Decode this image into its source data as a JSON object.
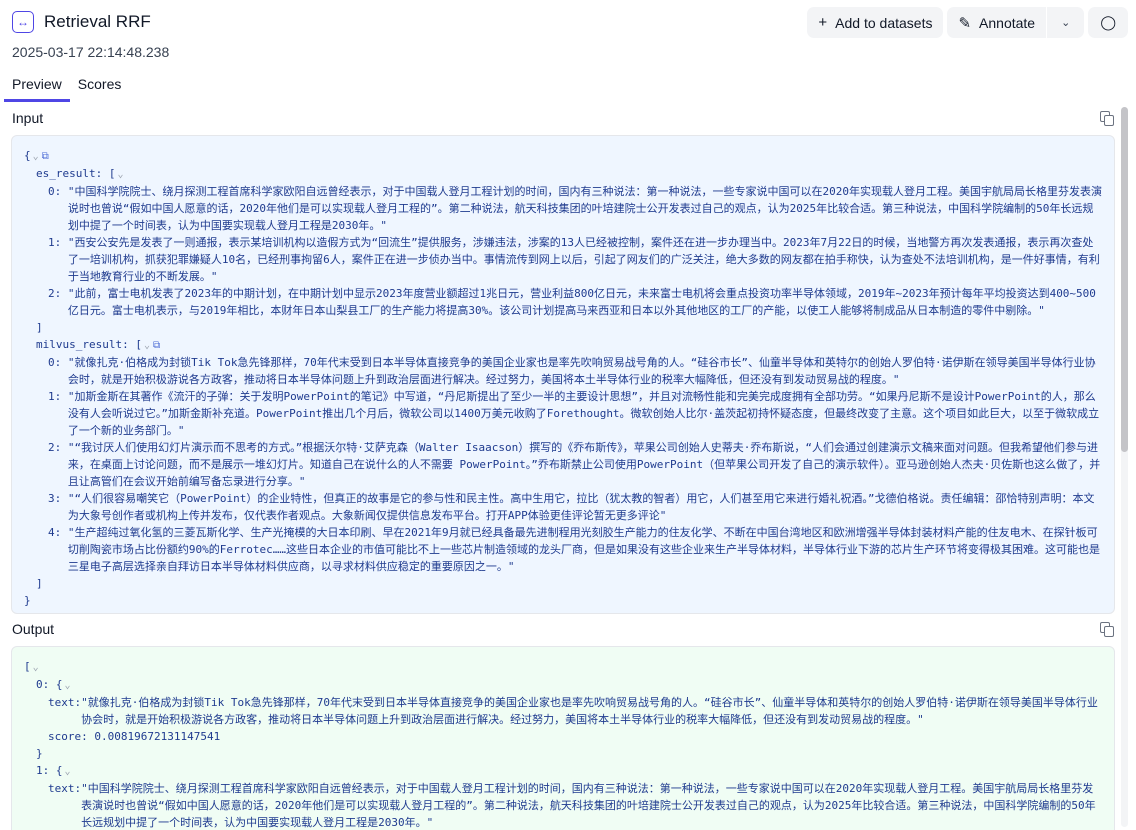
{
  "header": {
    "title": "Retrieval RRF",
    "timestamp": "2025-03-17 22:14:48.238",
    "add_to_datasets_label": "Add to datasets",
    "annotate_label": "Annotate"
  },
  "tabs": [
    {
      "label": "Preview",
      "active": true
    },
    {
      "label": "Scores",
      "active": false
    }
  ],
  "input": {
    "label": "Input",
    "es_result_key": "es_result:",
    "milvus_result_key": "milvus_result:",
    "es_result": [
      "\"中国科学院院士、绕月探测工程首席科学家欧阳自远曾经表示，对于中国载人登月工程计划的时间，国内有三种说法：第一种说法，一些专家说中国可以在2020年实现载人登月工程。美国宇航局局长格里芬发表演说时也曾说“假如中国人愿意的话，2020年他们是可以实现载人登月工程的”。第二种说法，航天科技集团的叶培建院士公开发表过自己的观点，认为2025年比较合适。第三种说法，中国科学院编制的50年长远规划中提了一个时间表，认为中国要实现载人登月工程是2030年。\"",
      "\"西安公安先是发表了一则通报，表示某培训机构以造假方式为“回流生”提供服务，涉嫌违法，涉案的13人已经被控制，案件还在进一步办理当中。2023年7月22日的时候，当地警方再次发表通报，表示再次查处了一培训机构，抓获犯罪嫌疑人10名，已经刑事拘留6人，案件正在进一步侦办当中。事情流传到网上以后，引起了网友们的广泛关注，绝大多数的网友都在拍手称快，认为查处不法培训机构，是一件好事情，有利于当地教育行业的不断发展。\"",
      "\"此前，富士电机发表了2023年的中期计划，在中期计划中显示2023年度营业额超过1兆日元，营业利益800亿日元，未来富士电机将会重点投资功率半导体领域，2019年~2023年预计每年平均投资达到400~500亿日元。富士电机表示，与2019年相比，本财年日本山梨县工厂的生产能力将提高30%。该公司计划提高马来西亚和日本以外其他地区的工厂的产能，以使工人能够将制成品从日本制造的零件中剔除。\""
    ],
    "milvus_result": [
      "\"就像扎克·伯格成为封锁Tik Tok急先锋那样，70年代末受到日本半导体直接竞争的美国企业家也是率先吹响贸易战号角的人。“硅谷市长”、仙童半导体和英特尔的创始人罗伯特·诺伊斯在领导美国半导体行业协会时，就是开始积极游说各方政客，推动将日本半导体问题上升到政治层面进行解决。经过努力，美国将本土半导体行业的税率大幅降低，但还没有到发动贸易战的程度。\"",
      "\"加斯金斯在其著作《流汗的子弹：关于发明PowerPoint的笔记》中写道，“丹尼斯提出了至少一半的主要设计思想”，并且对流畅性能和完美完成度拥有全部功劳。“如果丹尼斯不是设计PowerPoint的人，那么没有人会听说过它。”加斯金斯补充道。PowerPoint推出几个月后，微软公司以1400万美元收购了Forethought。微软创始人比尔·盖茨起初持怀疑态度，但最终改变了主意。这个项目如此巨大，以至于微软成立了一个新的业务部门。\"",
      "\"“我讨厌人们使用幻灯片演示而不思考的方式。”根据沃尔特·艾萨克森（Walter Isaacson）撰写的《乔布斯传》，苹果公司创始人史蒂夫·乔布斯说，“人们会通过创建演示文稿来面对问题。但我希望他们参与进来，在桌面上讨论问题，而不是展示一堆幻灯片。知道自己在说什么的人不需要 PowerPoint。”乔布斯禁止公司使用PowerPoint（但苹果公司开发了自己的演示软件）。亚马逊创始人杰夫·贝佐斯也这么做了，并且让高管们在会议开始前编写备忘录进行分享。\"",
      "\"“人们很容易嘲笑它（PowerPoint）的企业特性，但真正的故事是它的参与性和民主性。高中生用它，拉比（犹太教的智者）用它，人们甚至用它来进行婚礼祝酒。”戈德伯格说。责任编辑：邵恰特别声明：本文为大象号创作者或机构上传并发布，仅代表作者观点。大象新闻仅提供信息发布平台。打开APP体验更佳评论暂无更多评论\"",
      "\"生产超纯过氧化氢的三菱瓦斯化学、生产光掩模的大日本印刷、早在2021年9月就已经具备最先进制程用光刻胶生产能力的住友化学、不断在中国台湾地区和欧洲增强半导体封装材料产能的住友电木、在探针板可切削陶瓷市场占比份额约90%的Ferrotec……这些日本企业的市值可能比不上一些芯片制造领域的龙头厂商，但是如果没有这些企业来生产半导体材料，半导体行业下游的芯片生产环节将变得极其困难。这可能也是三星电子高层选择亲自拜访日本半导体材料供应商，以寻求材料供应稳定的重要原因之一。\""
    ]
  },
  "output": {
    "label": "Output",
    "items": [
      {
        "text": "\"就像扎克·伯格成为封锁Tik Tok急先锋那样，70年代末受到日本半导体直接竞争的美国企业家也是率先吹响贸易战号角的人。“硅谷市长”、仙童半导体和英特尔的创始人罗伯特·诺伊斯在领导美国半导体行业协会时，就是开始积极游说各方政客，推动将日本半导体问题上升到政治层面进行解决。经过努力，美国将本土半导体行业的税率大幅降低，但还没有到发动贸易战的程度。\"",
        "score": "0.00819672131147541"
      },
      {
        "text": "\"中国科学院院士、绕月探测工程首席科学家欧阳自远曾经表示，对于中国载人登月工程计划的时间，国内有三种说法：第一种说法，一些专家说中国可以在2020年实现载人登月工程。美国宇航局局长格里芬发表演说时也曾说“假如中国人愿意的话，2020年他们是可以实现载人登月工程的”。第二种说法，航天科技集团的叶培建院士公开发表过自己的观点，认为2025年比较合适。第三种说法，中国科学院编制的50年长远规划中提了一个时间表，认为中国要实现载人登月工程是2030年。\""
      }
    ]
  }
}
